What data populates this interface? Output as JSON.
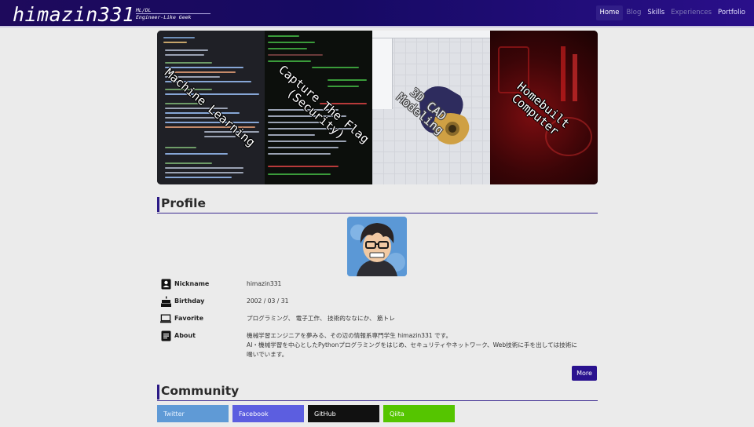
{
  "header": {
    "logo": "himazin331",
    "logo_sub_1": "ML/DL",
    "logo_sub_2": "Engineer-Like Geek",
    "nav": [
      "Home",
      "Blog",
      "Skills",
      "Experiences",
      "Portfolio"
    ],
    "active_nav": "Home"
  },
  "hero": {
    "panels": [
      {
        "label": "Machine Learning",
        "theme": "code-editor"
      },
      {
        "label": "Capture The Flag\n(Security)",
        "theme": "terminal"
      },
      {
        "label": "3D CAD\nModeling",
        "theme": "cad"
      },
      {
        "label": "Homebuilt\nComputer",
        "theme": "pc-red"
      }
    ]
  },
  "profile": {
    "heading": "Profile",
    "rows": [
      {
        "icon": "id-card-icon",
        "key": "Nickname",
        "value": "himazin331"
      },
      {
        "icon": "cake-icon",
        "key": "Birthday",
        "value": "2002 / 03 / 31"
      },
      {
        "icon": "laptop-icon",
        "key": "Favorite",
        "value": "プログラミング、 電子工作、 技術的ななにか、 筋トレ"
      },
      {
        "icon": "document-icon",
        "key": "About",
        "value_lines": [
          "機械学習エンジニアを夢みる、その辺の情報系専門学生 himazin331 です。",
          "AI・機械学習を中心としたPythonプログラミングをはじめ、セキュリティやネットワーク、Web技術に手を出しては技術に",
          "喘いでいます。"
        ]
      }
    ],
    "more_label": "More"
  },
  "community": {
    "heading": "Community",
    "links": [
      "Twitter",
      "Facebook",
      "GitHub",
      "Qiita"
    ]
  },
  "colors": {
    "header_bg": "#1e0a5c",
    "accent": "#2a128f",
    "twitter": "#5f9ad6",
    "facebook": "#5c5ee0",
    "github": "#111111",
    "qiita": "#55c500"
  }
}
